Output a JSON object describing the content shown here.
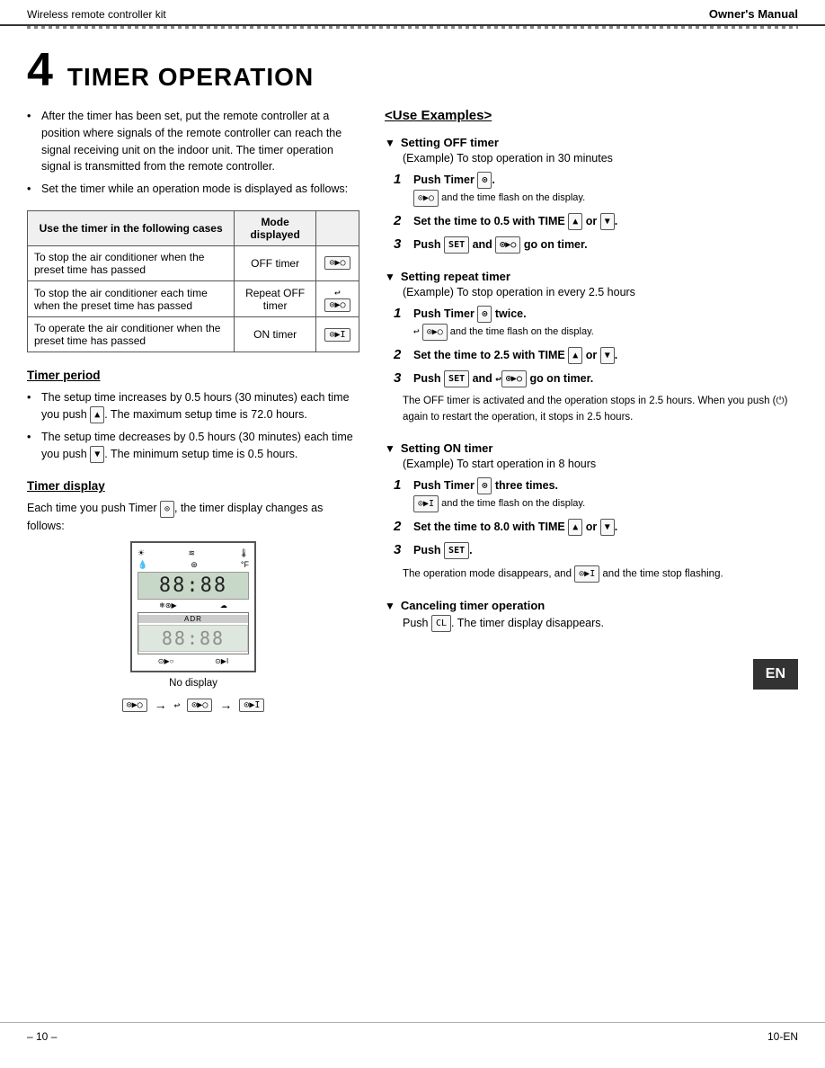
{
  "header": {
    "left": "Wireless remote controller kit",
    "right": "Owner's Manual"
  },
  "chapter": {
    "number": "4",
    "title": "TIMER OPERATION"
  },
  "intro_bullets": [
    "After the timer has been set, put the remote controller at a position where signals of the remote controller can reach the signal receiving unit on the indoor unit. The timer operation signal is transmitted from the remote controller.",
    "Set the timer while an operation mode is displayed as follows:"
  ],
  "table": {
    "header": [
      "Use the timer in the following cases",
      "Mode displayed",
      ""
    ],
    "rows": [
      {
        "cases": "To stop the air conditioner when the preset time has passed",
        "mode": "OFF timer",
        "icon": "⊙▶○"
      },
      {
        "cases": "To stop the air conditioner each time when the preset time has passed",
        "mode": "Repeat OFF timer",
        "icon": "↩ ⊙▶○"
      },
      {
        "cases": "To operate the air conditioner when the preset time has passed",
        "mode": "ON timer",
        "icon": "⊙▶I"
      }
    ]
  },
  "timer_period": {
    "header": "Timer period",
    "bullets": [
      "The setup time increases by 0.5 hours (30 minutes) each time you push [▲]. The maximum setup time is 72.0 hours.",
      "The setup time decreases by 0.5 hours (30 minutes) each time you push [▼]. The minimum setup time is 0.5 hours."
    ]
  },
  "timer_display": {
    "header": "Timer display",
    "text": "Each time you push Timer [⊙], the timer display changes as follows:"
  },
  "use_examples": {
    "title": "<Use Examples>",
    "groups": [
      {
        "title": "Setting OFF timer",
        "desc": "(Example) To stop operation in 30 minutes",
        "steps": [
          {
            "num": "1",
            "text": "Push Timer [⊙].",
            "sub": "⊙▶○ and the time flash on the display."
          },
          {
            "num": "2",
            "text": "Set the time to 0.5 with TIME [▲] or [▼].",
            "sub": ""
          },
          {
            "num": "3",
            "text": "Push [SET] and ⊙▶○ go on timer.",
            "sub": ""
          }
        ]
      },
      {
        "title": "Setting repeat timer",
        "desc": "(Example) To stop operation in every 2.5 hours",
        "steps": [
          {
            "num": "1",
            "text": "Push Timer [⊙] twice.",
            "sub": "↩ ⊙▶○ and the time flash on the display."
          },
          {
            "num": "2",
            "text": "Set the time to 2.5 with TIME [▲] or [▼].",
            "sub": ""
          },
          {
            "num": "3",
            "text": "Push [SET] and ↩⊙▶○ go on timer.",
            "sub": ""
          }
        ],
        "note": "The OFF timer is activated and the operation stops in 2.5 hours. When you push (⏻) again to restart the operation, it stops in 2.5 hours."
      },
      {
        "title": "Setting ON timer",
        "desc": "(Example) To start operation in 8 hours",
        "steps": [
          {
            "num": "1",
            "text": "Push Timer [⊙] three times.",
            "sub": "⊙▶I and the time flash on the display."
          },
          {
            "num": "2",
            "text": "Set the time to 8.0 with TIME [▲] or [▼].",
            "sub": ""
          },
          {
            "num": "3",
            "text": "Push [SET].",
            "sub": ""
          }
        ],
        "note": "The operation mode disappears, and ⊙▶I and the time stop flashing."
      },
      {
        "title": "Canceling timer operation",
        "steps": [],
        "cancel_text": "Push [CL]. The timer display disappears."
      }
    ]
  },
  "footer": {
    "page": "– 10 –",
    "code": "10-EN"
  },
  "diagram": {
    "no_display_label": "No display",
    "arrow_sequence": [
      "⊙▶○",
      "→",
      "↩⊙▶○",
      "→",
      "⊙▶I"
    ]
  }
}
